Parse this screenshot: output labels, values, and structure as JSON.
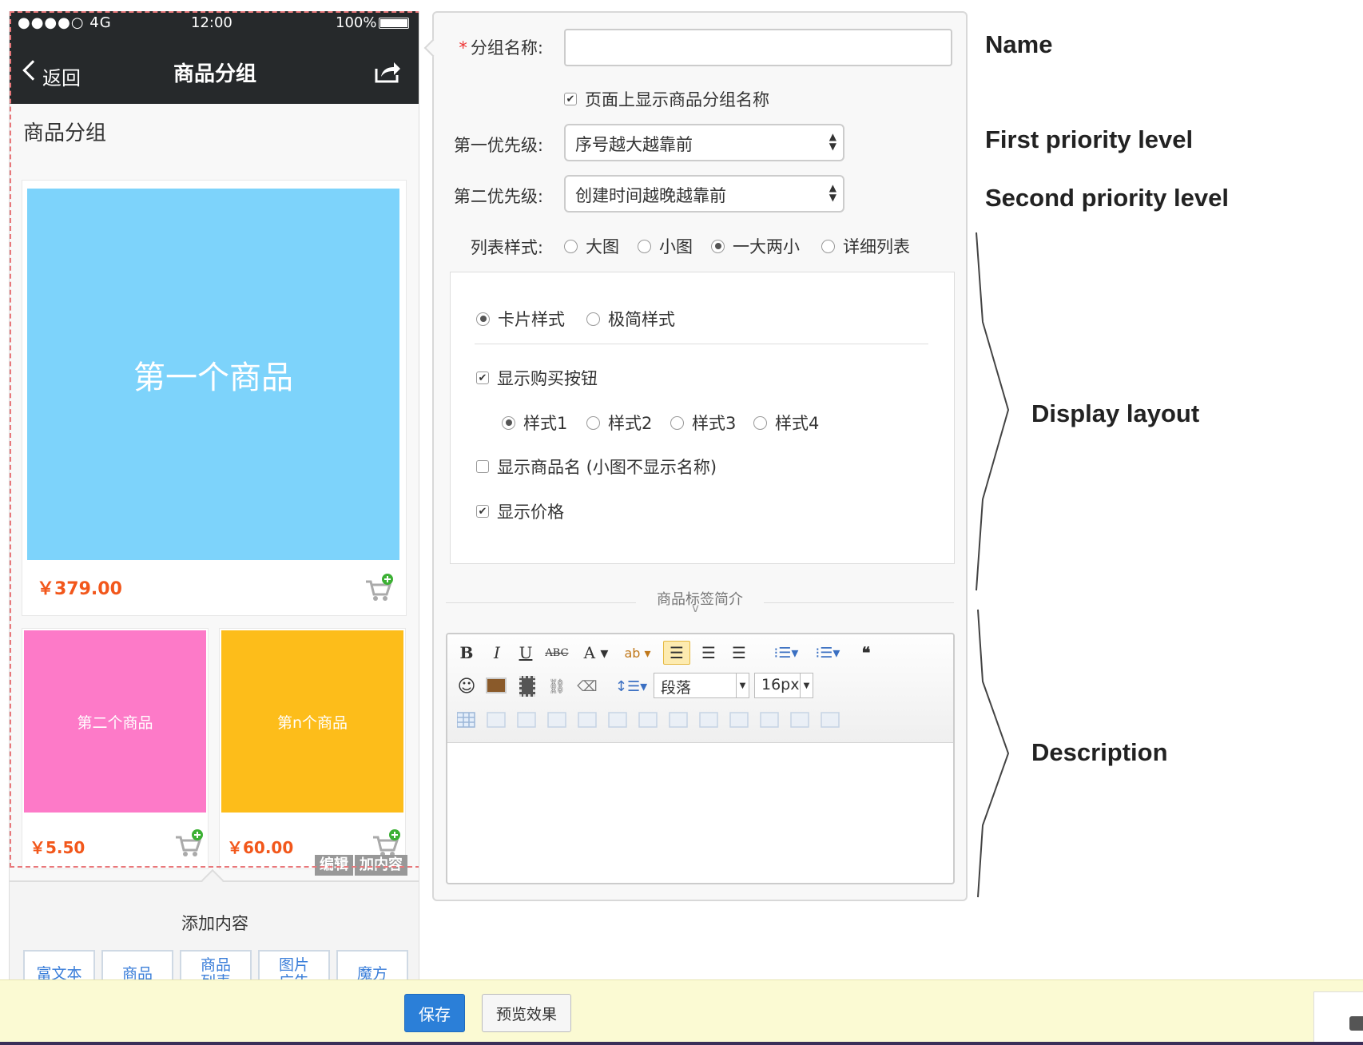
{
  "phone": {
    "status_bar": {
      "carrier": "●●●●○ 4G",
      "time": "12:00",
      "battery": "100%"
    },
    "nav": {
      "back_label": "返回",
      "title": "商品分组"
    },
    "group_title": "商品分组",
    "products": [
      {
        "name": "第一个商品",
        "price": "￥379.00",
        "color": "#7dd3fb"
      },
      {
        "name": "第二个商品",
        "price": "￥5.50",
        "color": "#fd7ac8"
      },
      {
        "name": "第n个商品",
        "price": "￥60.00",
        "color": "#fdbd1a"
      }
    ],
    "edit_actions": [
      "编辑",
      "加内容"
    ],
    "add_content": {
      "label": "添加内容",
      "buttons": [
        "富文本",
        "商品",
        "商品\n列表",
        "图片\n广告",
        "魔方"
      ]
    }
  },
  "form": {
    "name_label": "分组名称:",
    "name_value": "",
    "show_name_checkbox": {
      "label": "页面上显示商品分组名称",
      "checked": true
    },
    "first_priority": {
      "label": "第一优先级:",
      "value": "序号越大越靠前"
    },
    "second_priority": {
      "label": "第二优先级:",
      "value": "创建时间越晚越靠前"
    },
    "list_style": {
      "label": "列表样式:",
      "options": [
        "大图",
        "小图",
        "一大两小",
        "详细列表"
      ],
      "selected": "一大两小"
    },
    "display": {
      "card_style_options": [
        "卡片样式",
        "极简样式"
      ],
      "card_style_selected": "卡片样式",
      "show_buy_button": {
        "label": "显示购买按钮",
        "checked": true
      },
      "button_styles": [
        "样式1",
        "样式2",
        "样式3",
        "样式4"
      ],
      "button_style_selected": "样式1",
      "show_product_name": {
        "label": "显示商品名 (小图不显示名称)",
        "checked": false
      },
      "show_price": {
        "label": "显示价格",
        "checked": true
      }
    },
    "description": {
      "label": "商品标签简介",
      "chevron": "v",
      "toolbar": {
        "paragraph_select": "段落",
        "font_size_select": "16px"
      }
    }
  },
  "annotations": {
    "name": "Name",
    "first_priority": "First priority level",
    "second_priority": "Second priority level",
    "display_layout": "Display layout",
    "description": "Description"
  },
  "bottom_bar": {
    "save": "保存",
    "preview": "预览效果"
  },
  "colors": {
    "accent_blue": "#2b7fd8",
    "price_orange": "#f2571b",
    "nav_dark": "#26292b",
    "dashed_red": "#e8777a"
  }
}
